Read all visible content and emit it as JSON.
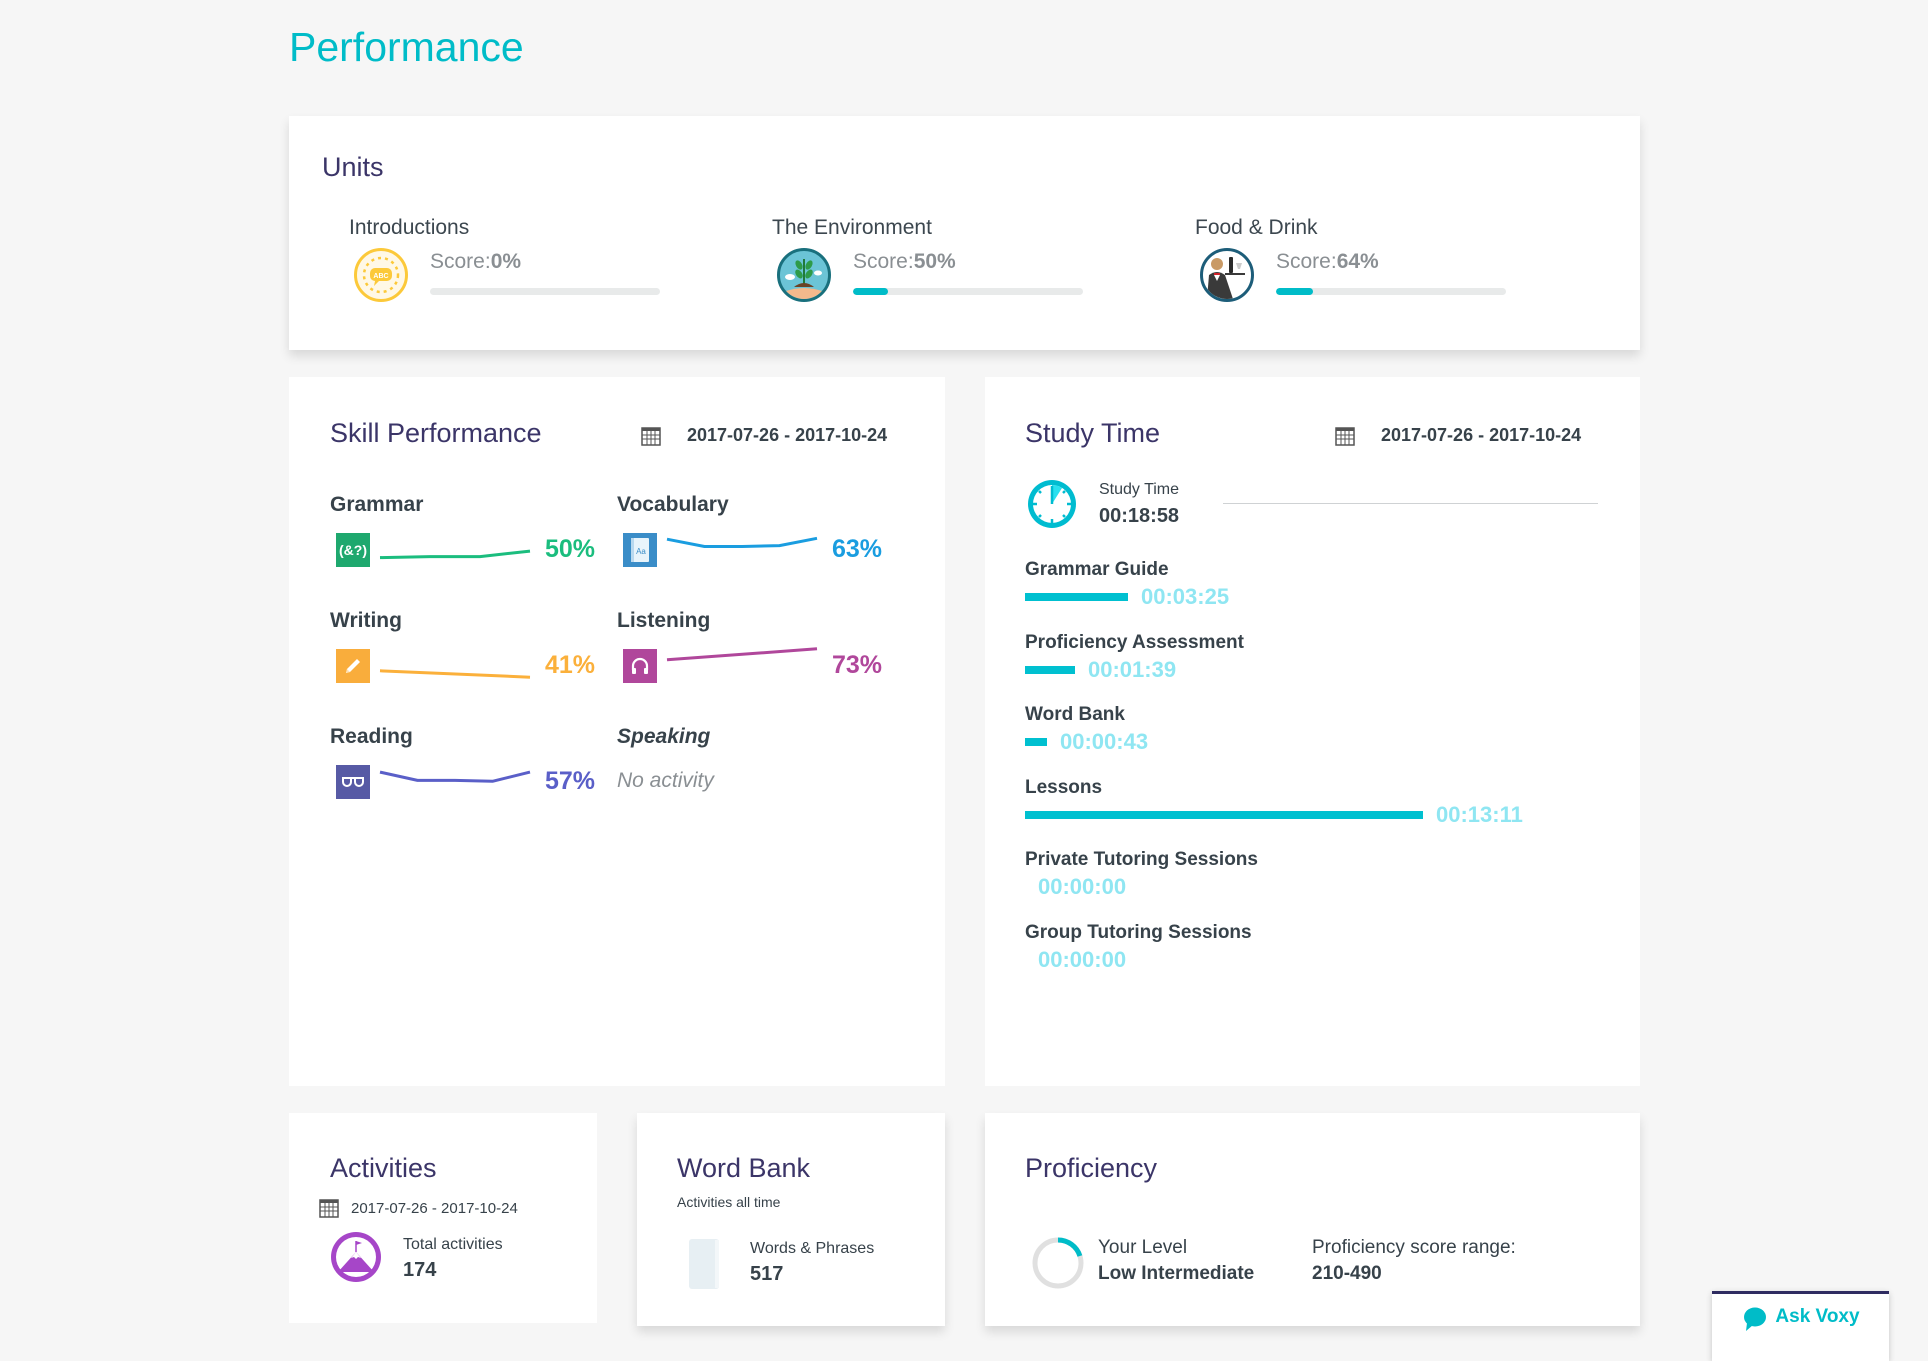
{
  "page": {
    "title": "Performance"
  },
  "colors": {
    "accent": "#00bcc8",
    "heading": "#3b3568",
    "grammar": "#1bbd7e",
    "vocabulary": "#1a9de0",
    "writing": "#fbb03b",
    "listening": "#b0479b",
    "reading": "#5a5fc8",
    "time_value": "#8fe6f2"
  },
  "units": {
    "title": "Units",
    "score_prefix": "Score:",
    "items": [
      {
        "name": "Introductions",
        "score": "0%",
        "icon": "abc-speech-badge-icon",
        "bar_fraction": 0.0
      },
      {
        "name": "The Environment",
        "score": "50%",
        "icon": "plant-in-hand-badge-icon",
        "bar_fraction": 0.15
      },
      {
        "name": "Food & Drink",
        "score": "64%",
        "icon": "waiter-badge-icon",
        "bar_fraction": 0.16
      }
    ]
  },
  "skill_performance": {
    "title": "Skill Performance",
    "date_range": "2017-07-26 - 2017-10-24",
    "skills": [
      {
        "name": "Grammar",
        "score": "50%",
        "icon": "grammar-symbols-icon",
        "trend": [
          45,
          46,
          46,
          52
        ]
      },
      {
        "name": "Vocabulary",
        "score": "63%",
        "icon": "vocabulary-book-icon",
        "trend": [
          65,
          57,
          57,
          58,
          66
        ]
      },
      {
        "name": "Writing",
        "score": "41%",
        "icon": "pencil-icon",
        "trend": [
          48,
          41
        ]
      },
      {
        "name": "Listening",
        "score": "73%",
        "icon": "headphones-icon",
        "trend": [
          60,
          72
        ]
      },
      {
        "name": "Reading",
        "score": "57%",
        "icon": "glasses-icon",
        "trend": [
          64,
          55,
          55,
          54,
          64
        ]
      },
      {
        "name": "Speaking",
        "score": null,
        "icon": null,
        "no_activity": "No activity"
      }
    ]
  },
  "study_time": {
    "title": "Study Time",
    "date_range": "2017-07-26 - 2017-10-24",
    "total_label": "Study Time",
    "total_value": "00:18:58",
    "rows": [
      {
        "label": "Grammar Guide",
        "time": "00:03:25",
        "seconds": 205
      },
      {
        "label": "Proficiency Assessment",
        "time": "00:01:39",
        "seconds": 99
      },
      {
        "label": "Word Bank",
        "time": "00:00:43",
        "seconds": 43
      },
      {
        "label": "Lessons",
        "time": "00:13:11",
        "seconds": 791
      },
      {
        "label": "Private Tutoring Sessions",
        "time": "00:00:00",
        "seconds": 0
      },
      {
        "label": "Group Tutoring Sessions",
        "time": "00:00:00",
        "seconds": 0
      }
    ]
  },
  "activities": {
    "title": "Activities",
    "date_range": "2017-07-26 - 2017-10-24",
    "label": "Total activities",
    "value": "174"
  },
  "word_bank": {
    "title": "Word Bank",
    "subtitle": "Activities all time",
    "label": "Words & Phrases",
    "value": "517"
  },
  "proficiency": {
    "title": "Proficiency",
    "level_label": "Your Level",
    "level_value": "Low Intermediate",
    "range_label": "Proficiency score range:",
    "range_value": "210-490",
    "ring_fraction": 0.2
  },
  "ask_voxy": {
    "label": "Ask Voxy"
  }
}
